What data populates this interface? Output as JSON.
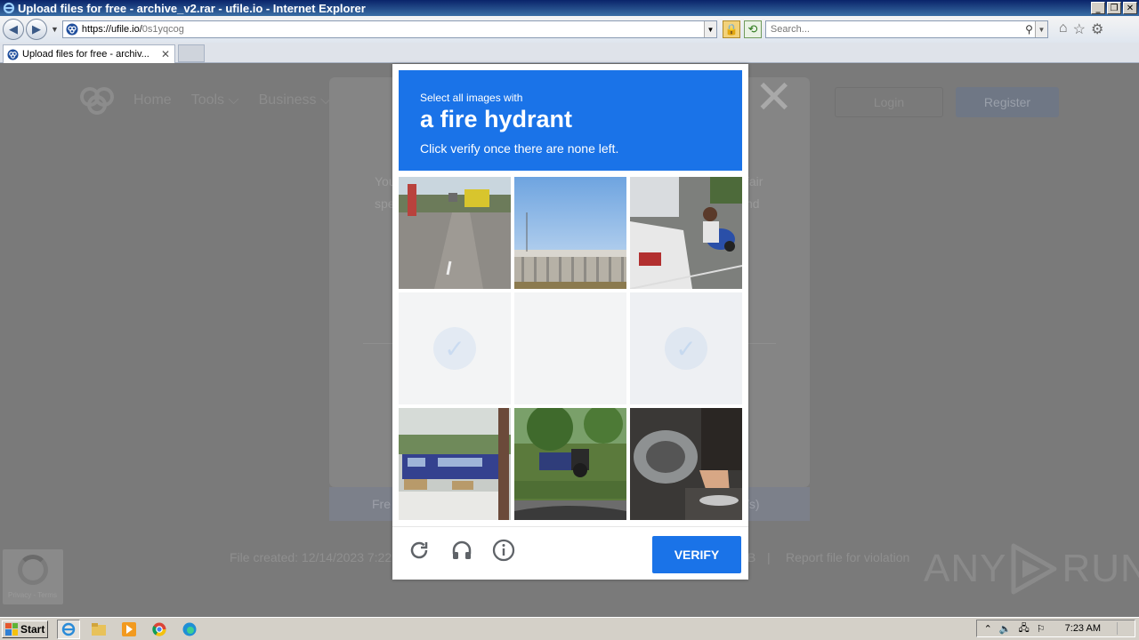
{
  "window": {
    "title": "Upload files for free - archive_v2.rar - ufile.io - Internet Explorer",
    "buttons": [
      "_",
      "❐",
      "✕"
    ]
  },
  "addressbar": {
    "url_main": "https://ufile.io/",
    "url_path": "0s1yqcog",
    "search_placeholder": "Search..."
  },
  "tab": {
    "title": "Upload files for free - archiv...",
    "close": "✕"
  },
  "site": {
    "nav": [
      "Home",
      "Tools ⌵",
      "Business ⌵"
    ],
    "login": "Login",
    "register": "Register",
    "modal_text_left": [
      "You",
      "spe"
    ],
    "modal_text_right": [
      "fair",
      "nd"
    ],
    "close_symbol": "✕",
    "free_left": "Fre",
    "free_right": "/s)",
    "file_created": "File created: 12/14/2023 7:22",
    "size_fragment": "B",
    "separator": "|",
    "report": "Report file for violation",
    "recaptcha_badge": "Privacy - Terms"
  },
  "captcha": {
    "line1": "Select all images with",
    "target": "a fire hydrant",
    "line3": "Click verify once there are none left.",
    "verify_label": "VERIFY",
    "tiles": [
      {
        "scene": "street-with-bus",
        "state": "image"
      },
      {
        "scene": "overpass-sky",
        "state": "image"
      },
      {
        "scene": "motorbike-parking",
        "state": "image"
      },
      {
        "scene": "fading",
        "state": "fading"
      },
      {
        "scene": "fading",
        "state": "fading"
      },
      {
        "scene": "fading",
        "state": "fading"
      },
      {
        "scene": "blue-buses",
        "state": "image"
      },
      {
        "scene": "tractor-park",
        "state": "image"
      },
      {
        "scene": "scooter-foot",
        "state": "image"
      }
    ]
  },
  "watermark": {
    "left": "ANY",
    "right": "RUN"
  },
  "taskbar": {
    "start": "Start",
    "clock": "7:23 AM"
  },
  "colors": {
    "accent": "#1a73e8",
    "overlay": "#7a7a7a"
  }
}
